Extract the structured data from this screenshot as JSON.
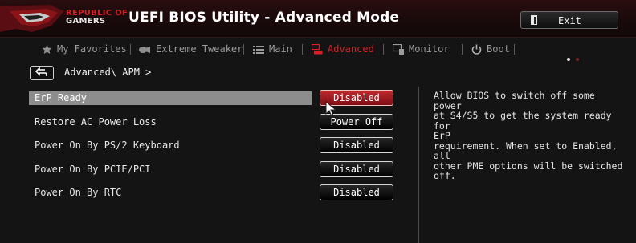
{
  "header": {
    "brand_line1": "REPUBLIC OF",
    "brand_line2": "GAMERS",
    "title": "UEFI BIOS Utility - Advanced Mode",
    "exit_label": "Exit",
    "logo_icon": "rog-eye-logo",
    "exit_icon": "door-icon"
  },
  "tabs": [
    {
      "label": "My Favorites",
      "icon": "star-icon"
    },
    {
      "label": "Extreme Tweaker",
      "icon": "tweaker-icon"
    },
    {
      "label": "Main",
      "icon": "list-icon"
    },
    {
      "label": "Advanced",
      "icon": "advanced-icon",
      "active": true
    },
    {
      "label": "Monitor",
      "icon": "monitor-icon"
    },
    {
      "label": "Boot",
      "icon": "power-icon"
    }
  ],
  "breadcrumb": "Advanced\\ APM >",
  "settings": [
    {
      "label": "ErP Ready",
      "value": "Disabled",
      "selected": true
    },
    {
      "label": "Restore AC Power Loss",
      "value": "Power Off"
    },
    {
      "label": "Power On By PS/2 Keyboard",
      "value": "Disabled"
    },
    {
      "label": "Power On By PCIE/PCI",
      "value": "Disabled"
    },
    {
      "label": "Power On By RTC",
      "value": "Disabled"
    }
  ],
  "help": {
    "text": "Allow BIOS to switch off some power\nat S4/S5 to get the system ready for\nErP\nrequirement. When set to Enabled, all\nother PME options will be switched\noff."
  },
  "colors": {
    "accent": "#d81f26",
    "selected_row": "#8d8d8d",
    "active_button": "#c02a2f"
  }
}
